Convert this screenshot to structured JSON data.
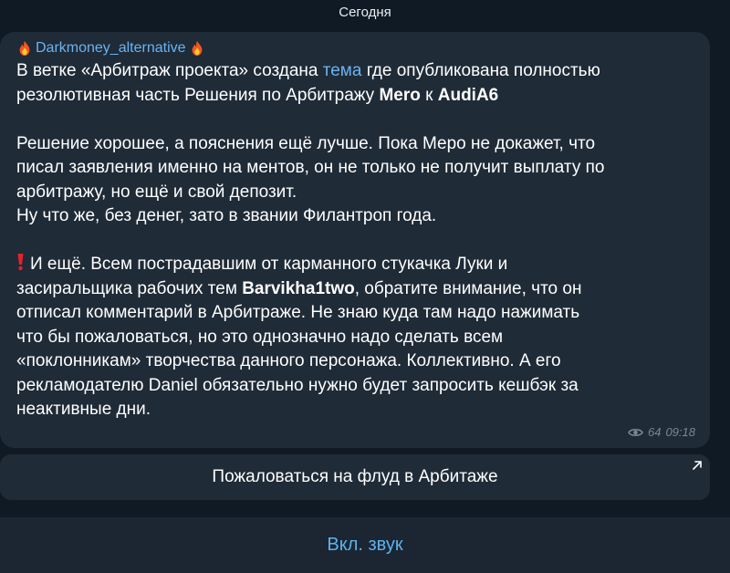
{
  "date_separator": "Сегодня",
  "message": {
    "sender": "Darkmoney_alternative",
    "p1": {
      "t1": "В ветке «Арбитраж проекта» создана ",
      "link": "тема",
      "t2": " где опубликована полностью",
      "t3": "резолютивная часть Решения по Арбитражу ",
      "b1": "Mero",
      "t4": " к ",
      "b2": "AudiA6"
    },
    "p2": [
      "Решение хорошее, а пояснения ещё лучше. Пока Меро не докажет, что",
      "писал заявления именно на ментов, он не только не получит выплату по",
      "арбитражу, но ещё и свой депозит.",
      "Ну что же, без денег, зато в звании Филантроп года."
    ],
    "p3": {
      "l1": "И ещё. Всем пострадавшим от карманного стукачка Луки и",
      "l2a": "засиральщика рабочих тем ",
      "l2b": "Barvikha1two",
      "l2c": ", обратите внимание, что он",
      "l3": "отписал комментарий в Арбитраже. Не знаю куда там надо нажимать",
      "l4": "что бы пожаловаться, но это однозначно надо сделать всем",
      "l5": "«поклонникам» творчества данного персонажа. Коллективно. А его",
      "l6": "рекламодателю Daniel обязательно нужно будет запросить кешбэк за",
      "l7": "неактивные дни."
    },
    "views": "64",
    "time": "09:18"
  },
  "inline_button": "Пожаловаться на флуд в Арбитаже",
  "bottom_action": "Вкл. звук",
  "colors": {
    "background": "#101a24",
    "bubble": "#1f2b37",
    "link": "#6ab3f3",
    "bottom_action": "#5fb1ee"
  },
  "icons": [
    "fire-icon",
    "exclamation-icon",
    "eye-icon",
    "arrow-up-right-icon"
  ]
}
